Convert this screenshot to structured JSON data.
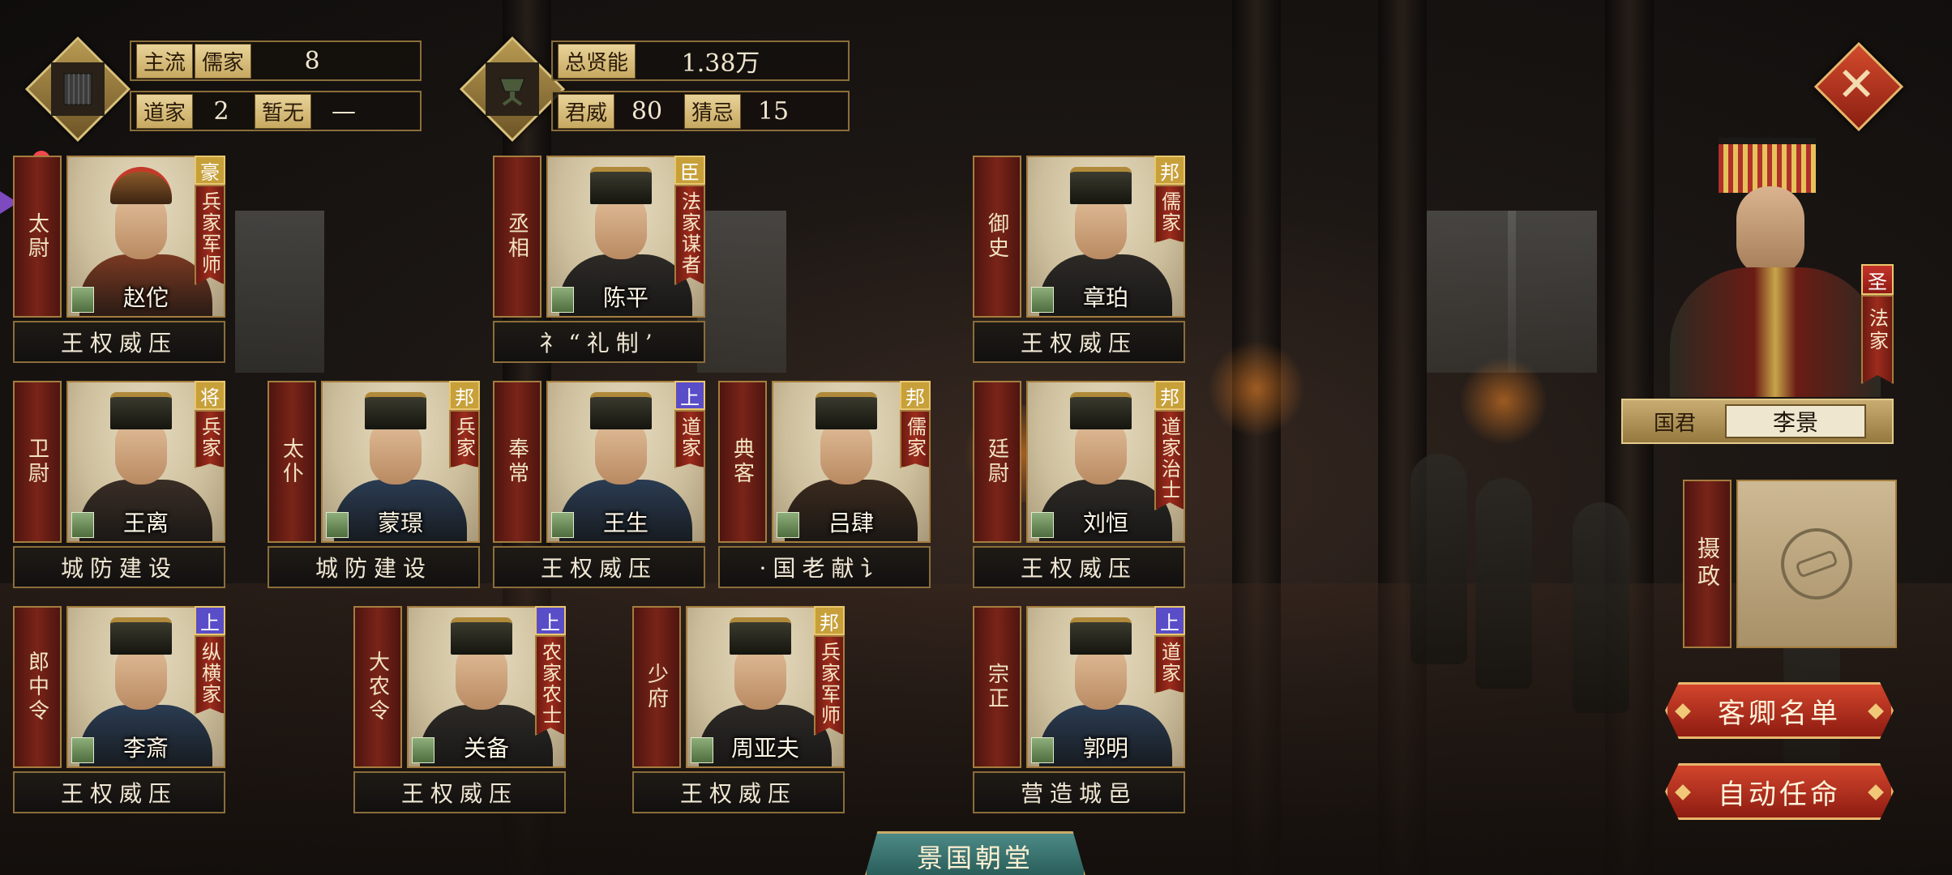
{
  "colors": {
    "badge_hao": "#c8a03a",
    "badge_chen": "#c8a03a",
    "badge_bang": "#c8a03a",
    "badge_jiang": "#c8a03a",
    "badge_shang": "#5a4dc8",
    "accent_red": "#8e1c12",
    "gold": "#e9c76e"
  },
  "stats_left": {
    "mainstream_label": "主流",
    "mainstream_school": "儒家",
    "mainstream_value": "8",
    "second_school": "道家",
    "second_value": "2",
    "none_label": "暂无",
    "none_value": "—",
    "icon": "bamboo-scroll-icon"
  },
  "stats_right": {
    "total_talent_label": "总贤能",
    "total_talent_value": "1.38万",
    "authority_label": "君威",
    "authority_value": "80",
    "suspicion_label": "猜忌",
    "suspicion_value": "15",
    "icon": "bronze-vessel-icon"
  },
  "officials": [
    {
      "title": "太尉",
      "name": "赵佗",
      "badge": "豪",
      "badge_color": "#c8a03a",
      "school": "兵家军师",
      "policy": "王权威压",
      "armor": true
    },
    {
      "title": "丞相",
      "name": "陈平",
      "badge": "臣",
      "badge_color": "#c8a03a",
      "school": "法家谋者",
      "policy": "礻“礼制’"
    },
    {
      "title": "御史",
      "name": "章珀",
      "badge": "邦",
      "badge_color": "#c8a03a",
      "school": "儒家",
      "policy": "王权威压"
    },
    {
      "title": "卫尉",
      "name": "王离",
      "badge": "将",
      "badge_color": "#c8a03a",
      "school": "兵家",
      "policy": "城防建设"
    },
    {
      "title": "太仆",
      "name": "蒙璟",
      "badge": "邦",
      "badge_color": "#c8a03a",
      "school": "兵家",
      "policy": "城防建设"
    },
    {
      "title": "奉常",
      "name": "王生",
      "badge": "上",
      "badge_color": "#5a4dc8",
      "school": "道家",
      "policy": "王权威压"
    },
    {
      "title": "典客",
      "name": "吕肆",
      "badge": "邦",
      "badge_color": "#c8a03a",
      "school": "儒家",
      "policy": "·国老献讠"
    },
    {
      "title": "廷尉",
      "name": "刘恒",
      "badge": "邦",
      "badge_color": "#c8a03a",
      "school": "道家治士",
      "policy": "王权威压"
    },
    {
      "title": "郎中令",
      "name": "李斎",
      "badge": "上",
      "badge_color": "#5a4dc8",
      "school": "纵横家",
      "policy": "王权威压"
    },
    {
      "title": "大农令",
      "name": "关备",
      "badge": "上",
      "badge_color": "#5a4dc8",
      "school": "农家农士",
      "policy": "王权威压"
    },
    {
      "title": "少府",
      "name": "周亚夫",
      "badge": "邦",
      "badge_color": "#c8a03a",
      "school": "兵家军师",
      "policy": "王权威压"
    },
    {
      "title": "宗正",
      "name": "郭明",
      "badge": "上",
      "badge_color": "#5a4dc8",
      "school": "道家",
      "policy": "营造城邑"
    }
  ],
  "ruler": {
    "badge": "圣",
    "school": "法家",
    "label": "国君",
    "name": "李景"
  },
  "regent": {
    "label": "摄政",
    "icon": "empty-slot-icon"
  },
  "buttons": {
    "guest_list": "客卿名单",
    "auto_appoint": "自动任命",
    "close": "✕"
  },
  "court_tab": "景国朝堂"
}
